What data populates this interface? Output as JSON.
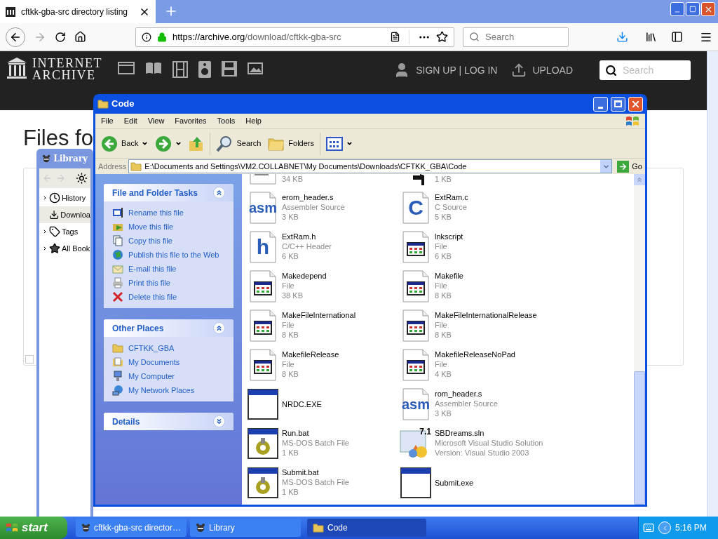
{
  "browser": {
    "tab": {
      "title": "cftkk-gba-src directory listing",
      "selected": true
    },
    "url": {
      "host": "https://archive.org",
      "path": "/download/cftkk-gba-src"
    },
    "search": {
      "placeholder": "Search"
    }
  },
  "site_header": {
    "logo": [
      "INTERNET",
      "ARCHIVE"
    ],
    "account": "SIGN UP | LOG IN",
    "upload": "UPLOAD",
    "search": {
      "placeholder": "Search"
    }
  },
  "page": {
    "heading": "Files fo"
  },
  "library_window": {
    "title": "Library",
    "items": [
      {
        "label": "History",
        "kind": "history",
        "expandable": true,
        "selected": false
      },
      {
        "label": "Downloa",
        "kind": "downloads",
        "expandable": false,
        "selected": true
      },
      {
        "label": "Tags",
        "kind": "tags",
        "expandable": true,
        "selected": false
      },
      {
        "label": "All Book",
        "kind": "bookmarks",
        "expandable": true,
        "selected": false
      }
    ]
  },
  "explorer": {
    "title": "Code",
    "menu": [
      "File",
      "Edit",
      "View",
      "Favorites",
      "Tools",
      "Help"
    ],
    "toolbar": [
      {
        "kind": "back",
        "label": "Back"
      },
      {
        "kind": "forward"
      },
      {
        "kind": "up"
      },
      {
        "kind": "search",
        "label": "Search"
      },
      {
        "kind": "folders",
        "label": "Folders"
      },
      {
        "kind": "views"
      }
    ],
    "address": {
      "label": "Address",
      "value": "E:\\Documents and Settings\\VM2.COLLABNET\\My Documents\\Downloads\\CFTKK_GBA\\Code",
      "go": "Go"
    },
    "panels": [
      {
        "title": "File and Folder Tasks",
        "expanded": true,
        "links": [
          {
            "kind": "rename",
            "label": "Rename this file"
          },
          {
            "kind": "move",
            "label": "Move this file"
          },
          {
            "kind": "copy",
            "label": "Copy this file"
          },
          {
            "kind": "publish",
            "label": "Publish this file to the Web"
          },
          {
            "kind": "email",
            "label": "E-mail this file"
          },
          {
            "kind": "print",
            "label": "Print this file"
          },
          {
            "kind": "delete",
            "label": "Delete this file"
          }
        ]
      },
      {
        "title": "Other Places",
        "expanded": true,
        "links": [
          {
            "kind": "folder",
            "label": "CFTKK_GBA"
          },
          {
            "kind": "documents",
            "label": "My Documents"
          },
          {
            "kind": "computer",
            "label": "My Computer"
          },
          {
            "kind": "network",
            "label": "My Network Places"
          }
        ]
      },
      {
        "title": "Details",
        "expanded": false
      }
    ],
    "files": [
      {
        "kind": "text",
        "details": [
          "34 KB"
        ]
      },
      {
        "kind": "arrow",
        "details": [
          "1 KB"
        ]
      },
      {
        "kind": "code",
        "icon_label": "asm",
        "name": "erom_header.s",
        "details": [
          "Assembler Source",
          "3 KB"
        ]
      },
      {
        "kind": "code",
        "icon_label": "C",
        "name": "ExtRam.c",
        "details": [
          "C Source",
          "5 KB"
        ]
      },
      {
        "kind": "code",
        "icon_label": "h",
        "name": "ExtRam.h",
        "details": [
          "C/C++ Header",
          "6 KB"
        ]
      },
      {
        "kind": "file",
        "name": "lnkscript",
        "details": [
          "File",
          "6 KB"
        ]
      },
      {
        "kind": "file",
        "name": "Makedepend",
        "details": [
          "File",
          "38 KB"
        ]
      },
      {
        "kind": "file",
        "name": "Makefile",
        "details": [
          "File",
          "8 KB"
        ]
      },
      {
        "kind": "file",
        "name": "MakeFileInternational",
        "details": [
          "File",
          "8 KB"
        ]
      },
      {
        "kind": "file",
        "name": "MakeFileInternationalRelease",
        "details": [
          "File",
          "8 KB"
        ]
      },
      {
        "kind": "file",
        "name": "MakefileRelease",
        "details": [
          "File",
          "8 KB"
        ]
      },
      {
        "kind": "file",
        "name": "MakefileReleaseNoPad",
        "details": [
          "File",
          "4 KB"
        ]
      },
      {
        "kind": "exe",
        "name": "NRDC.EXE"
      },
      {
        "kind": "code",
        "icon_label": "asm",
        "name": "rom_header.s",
        "details": [
          "Assembler Source",
          "3 KB"
        ]
      },
      {
        "kind": "bat",
        "name": "Run.bat",
        "details": [
          "MS-DOS Batch File",
          "1 KB"
        ]
      },
      {
        "kind": "sln",
        "icon_label": "7.1",
        "name": "SBDreams.sln",
        "details": [
          "Microsoft Visual Studio Solution",
          "Version: Visual Studio 2003"
        ]
      },
      {
        "kind": "bat",
        "name": "Submit.bat",
        "details": [
          "MS-DOS Batch File",
          "1 KB"
        ]
      },
      {
        "kind": "exe",
        "name": "Submit.exe"
      }
    ]
  },
  "taskbar": {
    "start": "start",
    "tasks": [
      {
        "kind": "browser",
        "label": "cftkk-gba-src director…",
        "selected": false
      },
      {
        "kind": "browser",
        "label": "Library",
        "selected": false
      },
      {
        "kind": "folder",
        "label": "Code",
        "selected": true
      }
    ],
    "clock": "5:16 PM"
  }
}
